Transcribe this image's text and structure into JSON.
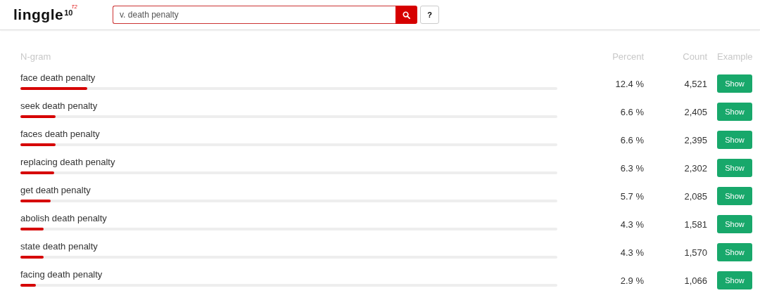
{
  "logo": {
    "name": "linggle",
    "version": "10",
    "tag": "T2"
  },
  "search": {
    "value": "v. death penalty"
  },
  "help_button": "?",
  "table": {
    "columns": [
      "N-gram",
      "Percent",
      "Count",
      "Example"
    ],
    "rows": [
      {
        "ngram": "face death penalty",
        "level": 0.124,
        "percent": "12.4 %",
        "count": "4,521",
        "action": "Show"
      },
      {
        "ngram": "seek death penalty",
        "level": 0.066,
        "percent": "6.6 %",
        "count": "2,405",
        "action": "Show"
      },
      {
        "ngram": "faces death penalty",
        "level": 0.066,
        "percent": "6.6 %",
        "count": "2,395",
        "action": "Show"
      },
      {
        "ngram": "replacing death penalty",
        "level": 0.063,
        "percent": "6.3 %",
        "count": "2,302",
        "action": "Show"
      },
      {
        "ngram": "get death penalty",
        "level": 0.057,
        "percent": "5.7 %",
        "count": "2,085",
        "action": "Show"
      },
      {
        "ngram": "abolish death penalty",
        "level": 0.043,
        "percent": "4.3 %",
        "count": "1,581",
        "action": "Show"
      },
      {
        "ngram": "state death penalty",
        "level": 0.043,
        "percent": "4.3 %",
        "count": "1,570",
        "action": "Show"
      },
      {
        "ngram": "facing death penalty",
        "level": 0.029,
        "percent": "2.9 %",
        "count": "1,066",
        "action": "Show"
      }
    ]
  }
}
